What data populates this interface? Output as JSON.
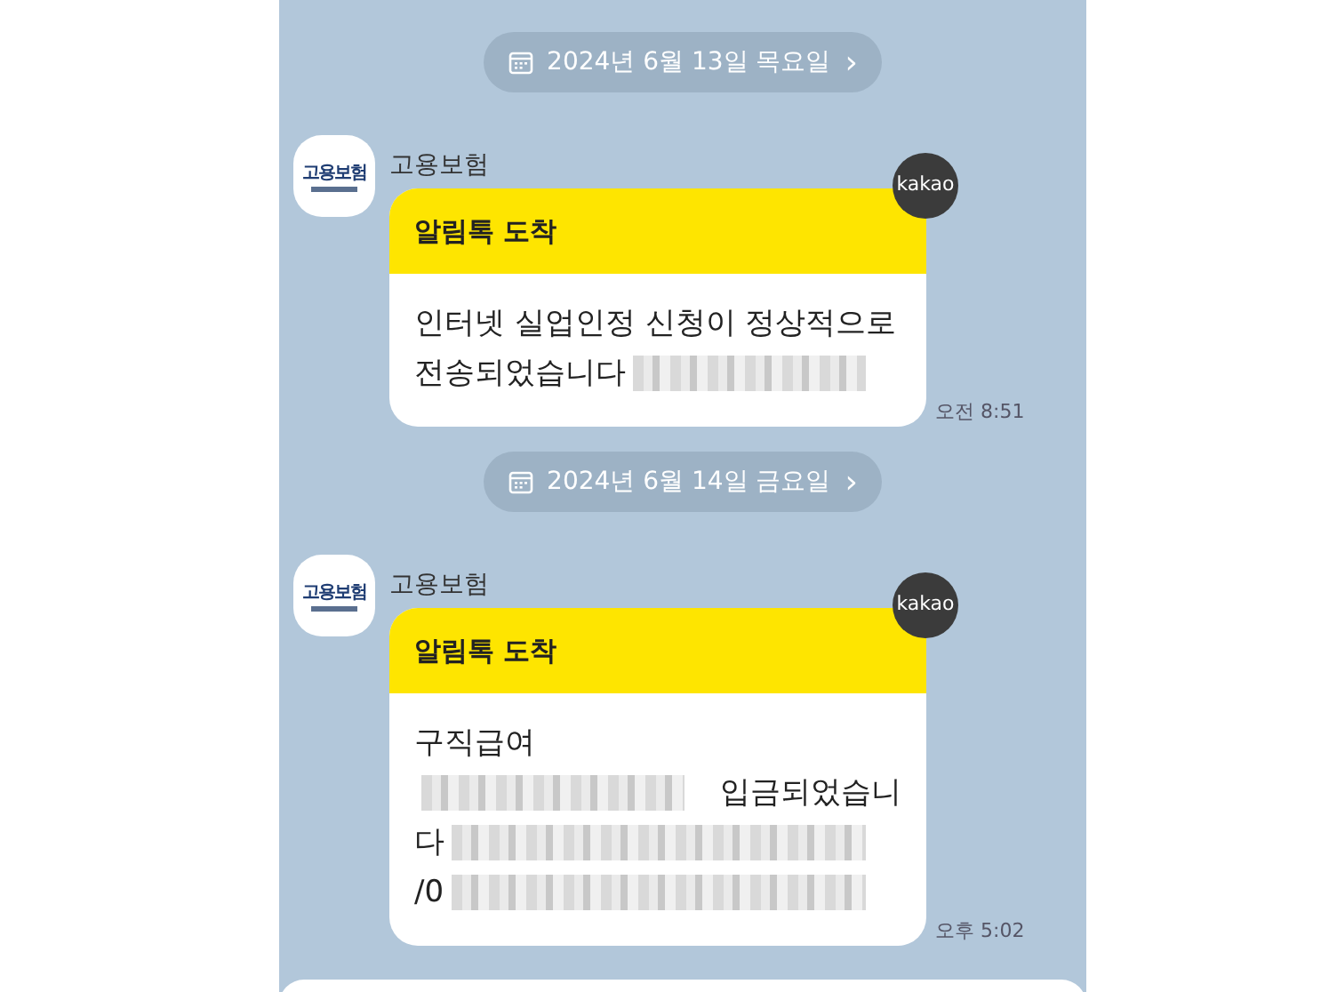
{
  "days": [
    {
      "date": "2024년 6월 13일 목요일",
      "chevron": "›",
      "messages": [
        {
          "sender": "고용보험",
          "logo_text": "고용보험",
          "badge": "kakao",
          "header": "알림톡 도착",
          "time": "오전 8:51",
          "lines": [
            [
              {
                "kind": "text",
                "text": "인터넷 실업인정 신청이 정상적으로"
              }
            ],
            [
              {
                "kind": "text",
                "text": "전송되었습니다"
              },
              {
                "kind": "redacted"
              }
            ]
          ]
        }
      ]
    },
    {
      "date": "2024년 6월 14일 금요일",
      "chevron": "›",
      "messages": [
        {
          "sender": "고용보험",
          "logo_text": "고용보험",
          "badge": "kakao",
          "header": "알림톡 도착",
          "time": "오후 5:02",
          "lines": [
            [
              {
                "kind": "text",
                "text": "구직급여"
              }
            ],
            [
              {
                "kind": "redacted"
              },
              {
                "kind": "text",
                "text": "입금되었습니"
              }
            ],
            [
              {
                "kind": "text",
                "text": "다"
              },
              {
                "kind": "redacted"
              }
            ],
            [
              {
                "kind": "text",
                "text": "/0"
              },
              {
                "kind": "redacted"
              }
            ]
          ]
        }
      ]
    }
  ]
}
